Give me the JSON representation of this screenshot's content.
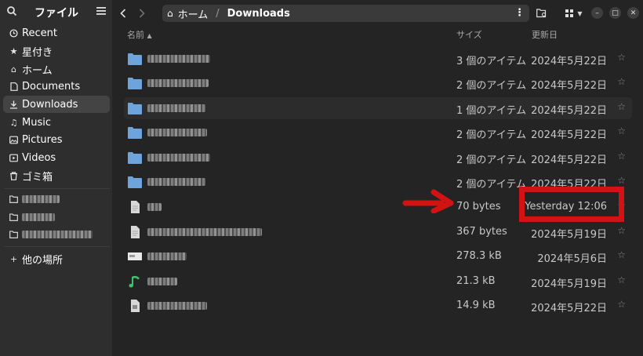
{
  "sidebar": {
    "title": "ファイル",
    "icons": {
      "search": "search-icon",
      "menu": "hamburger-menu-icon"
    },
    "places": [
      {
        "label": "Recent",
        "icon": "clock-icon"
      },
      {
        "label": "星付き",
        "icon": "star-icon"
      },
      {
        "label": "ホーム",
        "icon": "home-icon"
      },
      {
        "label": "Documents",
        "icon": "document-icon"
      },
      {
        "label": "Downloads",
        "icon": "download-icon",
        "active": true
      },
      {
        "label": "Music",
        "icon": "music-icon"
      },
      {
        "label": "Pictures",
        "icon": "picture-icon"
      },
      {
        "label": "Videos",
        "icon": "video-icon"
      },
      {
        "label": "ゴミ箱",
        "icon": "trash-icon"
      }
    ],
    "other_locations": "他の場所"
  },
  "toolbar": {
    "path_home": "ホーム",
    "path_separator": "/",
    "path_current": "Downloads"
  },
  "columns": {
    "name": "名前",
    "size": "サイズ",
    "modified": "更新日"
  },
  "files": [
    {
      "type": "folder",
      "size": "3 個のアイテム",
      "modified": "2024年5月22日"
    },
    {
      "type": "folder",
      "size": "2 個のアイテム",
      "modified": "2024年5月22日"
    },
    {
      "type": "folder",
      "size": "1 個のアイテム",
      "modified": "2024年5月22日"
    },
    {
      "type": "folder",
      "size": "2 個のアイテム",
      "modified": "2024年5月22日"
    },
    {
      "type": "folder",
      "size": "2 個のアイテム",
      "modified": "2024年5月22日"
    },
    {
      "type": "folder",
      "size": "2 個のアイテム",
      "modified": "2024年5月22日"
    },
    {
      "type": "text",
      "size": "70 bytes",
      "modified": "Yesterday 12:06"
    },
    {
      "type": "text",
      "size": "367 bytes",
      "modified": "2024年5月19日"
    },
    {
      "type": "image",
      "size": "278.3 kB",
      "modified": "2024年5月6日"
    },
    {
      "type": "audio",
      "size": "21.3 kB",
      "modified": "2024年5月19日"
    },
    {
      "type": "document",
      "size": "14.9 kB",
      "modified": "2024年5月22日"
    }
  ],
  "colors": {
    "accent_annotation": "#d21313",
    "folder": "#6fa3dc",
    "audio": "#3fbf6f"
  }
}
